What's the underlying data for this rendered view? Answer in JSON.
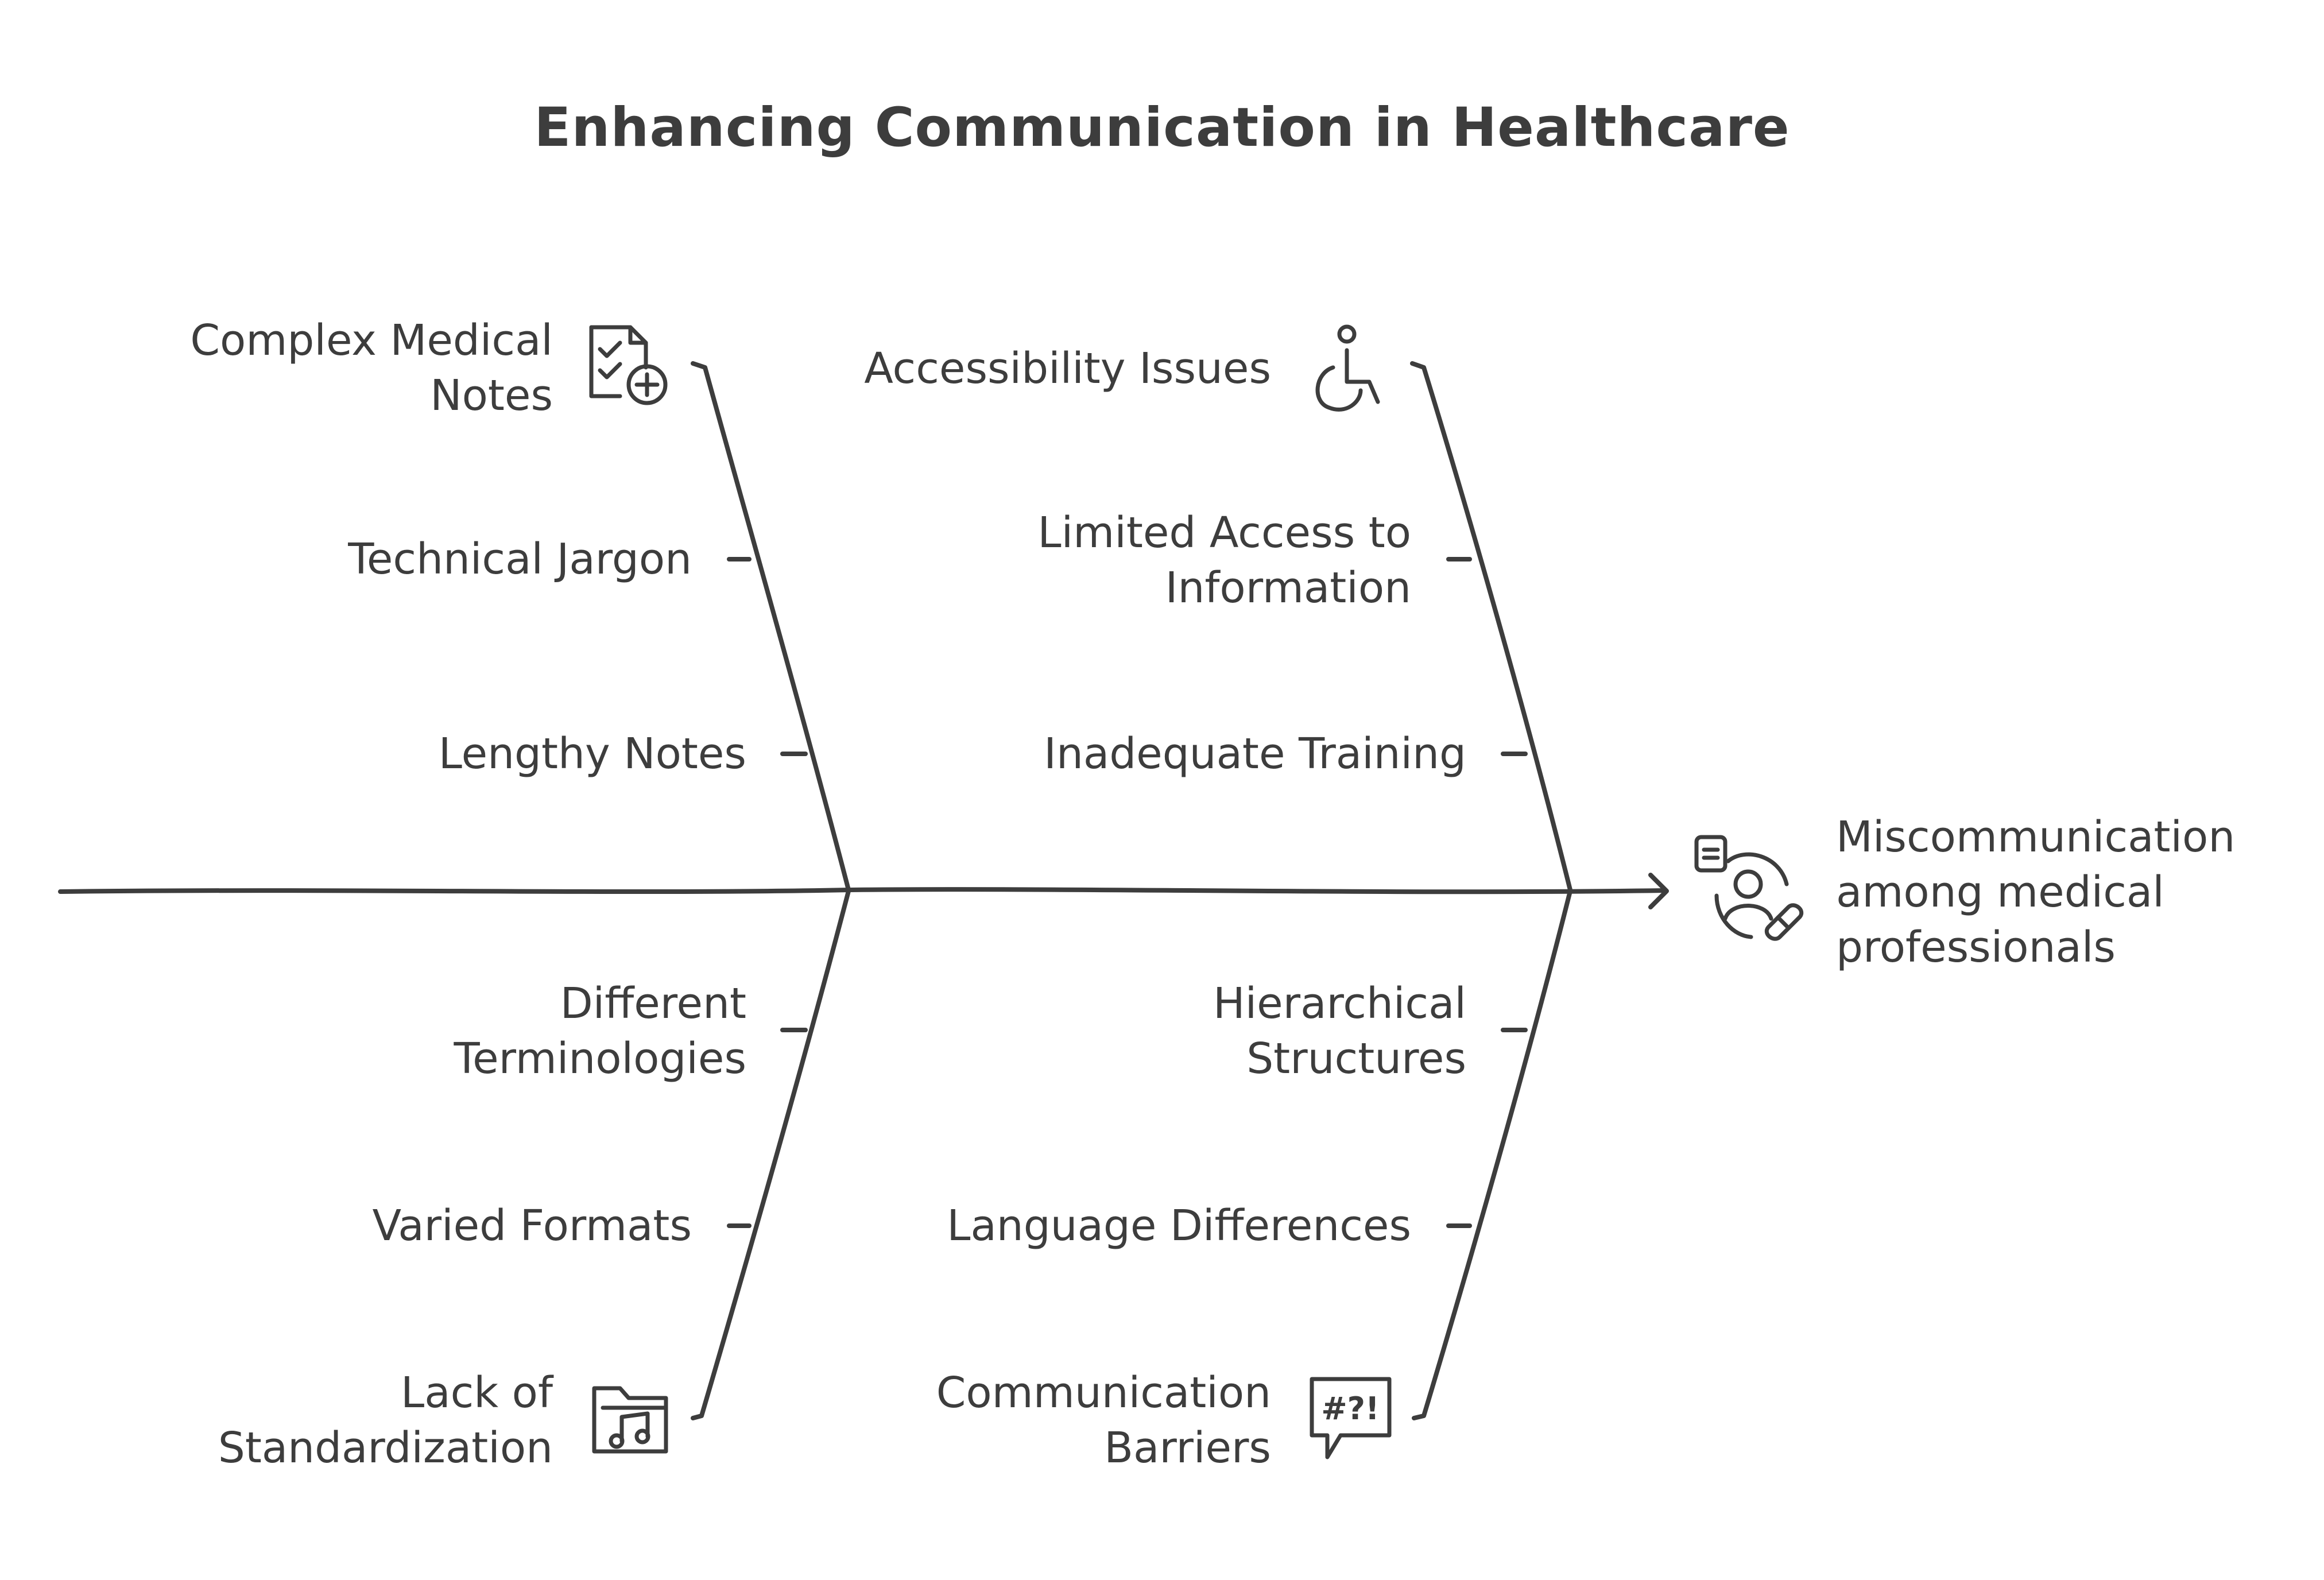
{
  "title": "Enhancing Communication in Healthcare",
  "effect": {
    "label": "Miscommunication among medical professionals",
    "lines": [
      "Miscommunication",
      "among medical",
      "professionals"
    ],
    "icon": "medical-professional-icon"
  },
  "causes": {
    "top_left": [
      {
        "label": "Complex Medical Notes",
        "lines": [
          "Complex Medical",
          "Notes"
        ],
        "icon": "medical-document-icon"
      },
      {
        "label": "Technical Jargon",
        "lines": [
          "Technical Jargon"
        ]
      },
      {
        "label": "Lengthy Notes",
        "lines": [
          "Lengthy Notes"
        ]
      }
    ],
    "top_right": [
      {
        "label": "Accessibility Issues",
        "lines": [
          "Accessibility Issues"
        ],
        "icon": "wheelchair-icon"
      },
      {
        "label": "Limited Access to Information",
        "lines": [
          "Limited Access to",
          "Information"
        ]
      },
      {
        "label": "Inadequate Training",
        "lines": [
          "Inadequate Training"
        ]
      }
    ],
    "bottom_left": [
      {
        "label": "Different Terminologies",
        "lines": [
          "Different",
          "Terminologies"
        ]
      },
      {
        "label": "Varied Formats",
        "lines": [
          "Varied Formats"
        ]
      },
      {
        "label": "Lack of Standardization",
        "lines": [
          "Lack of",
          "Standardization"
        ],
        "icon": "music-folder-icon"
      }
    ],
    "bottom_right": [
      {
        "label": "Hierarchical Structures",
        "lines": [
          "Hierarchical",
          "Structures"
        ]
      },
      {
        "label": "Language Differences",
        "lines": [
          "Language Differences"
        ]
      },
      {
        "label": "Communication Barriers",
        "lines": [
          "Communication",
          "Barriers"
        ],
        "icon": "speech-bubble-icon"
      }
    ]
  },
  "colors": {
    "stroke": "#3d3d3d",
    "text": "#3d3d3d",
    "background": "#ffffff"
  }
}
